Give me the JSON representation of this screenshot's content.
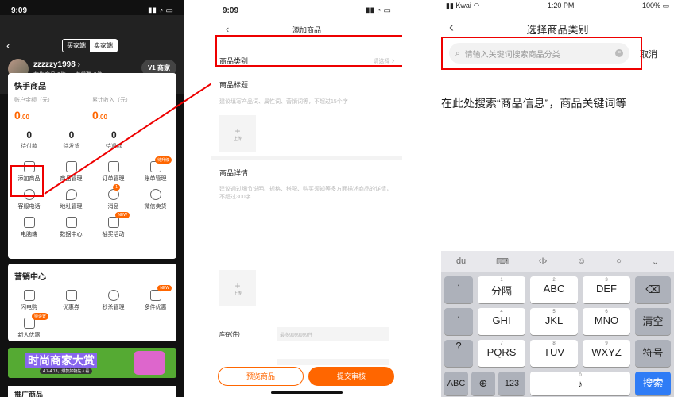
{
  "panel1": {
    "status_time": "9:09",
    "seg_buyer": "买家端",
    "seg_seller": "卖家端",
    "username": "zzzzzy1998",
    "stat_sale": "在售商品 2件",
    "stat_sold": "总销量 0件",
    "merchant": "商家",
    "section_title": "快手商品",
    "balance_label": "账户金额（元）",
    "balance_value": "0",
    "balance_dec": ".00",
    "income_label": "累计收入（元）",
    "income_value": "0",
    "income_dec": ".00",
    "orders": [
      {
        "n": "0",
        "label": "待付款"
      },
      {
        "n": "0",
        "label": "待发货"
      },
      {
        "n": "0",
        "label": "待退款"
      }
    ],
    "tools": [
      {
        "label": "添加商品",
        "badge": ""
      },
      {
        "label": "商品管理",
        "badge": ""
      },
      {
        "label": "订单管理",
        "badge": ""
      },
      {
        "label": "账单管理",
        "badge": "待升级"
      },
      {
        "label": "客服电话",
        "badge": ""
      },
      {
        "label": "地址管理",
        "badge": ""
      },
      {
        "label": "消息",
        "badge": "1"
      },
      {
        "label": "微信卖货",
        "badge": ""
      },
      {
        "label": "电脑端",
        "badge": ""
      },
      {
        "label": "数据中心",
        "badge": ""
      },
      {
        "label": "抽奖活动",
        "badge": "NEW"
      }
    ],
    "marketing_title": "营销中心",
    "marketing": [
      {
        "label": "闪电购",
        "badge": ""
      },
      {
        "label": "优惠券",
        "badge": ""
      },
      {
        "label": "秒杀管理",
        "badge": ""
      },
      {
        "label": "多件优惠",
        "badge": "NEW"
      },
      {
        "label": "新人优惠",
        "badge": "待设置"
      }
    ],
    "banner_title": "时尚商家大赏",
    "banner_sub": "4.7-4.13，爆款好物先人看",
    "footer_title": "推广商品"
  },
  "panel2": {
    "status_time": "9:09",
    "title": "添加商品",
    "category_label": "商品类别",
    "category_value": "请选择",
    "name_label": "商品标题",
    "name_hint": "建议填写产品词、属性词、营销词等，不超过15个字",
    "upload": "上传",
    "detail_label": "商品详情",
    "detail_hint": "建议通过细节说明、规格、搭配、购买须知等多方面描述商品的详情，不超过300字",
    "stock_label": "库存(件)",
    "stock_placeholder": "最多9999999件",
    "preview_btn": "预览商品",
    "submit_btn": "提交审核"
  },
  "panel3": {
    "carrier": "Kwai",
    "status_time": "1:20 PM",
    "battery": "100%",
    "title": "选择商品类别",
    "search_placeholder": "请输入关键词搜索商品分类",
    "cancel": "取消",
    "hint": "在此处搜索“商品信息”，商品关键词等",
    "keys": {
      "k1": ",",
      "k2": "分隔",
      "k3": "ABC",
      "k4": "DEF",
      "k5": ".",
      "k6": "GHI",
      "k7": "JKL",
      "k8": "MNO",
      "k9": "清空",
      "k10": "?",
      "k11": "PQRS",
      "k12": "TUV",
      "k13": "WXYZ",
      "k14": "符号",
      "k15": "ABC",
      "k16": "123",
      "k17": "搜索",
      "n1": "1",
      "n2": "2",
      "n3": "3",
      "n4": "4",
      "n5": "5",
      "n6": "6",
      "n7": "7",
      "n8": "8",
      "n9": "9",
      "n0": "0"
    }
  },
  "colors": {
    "accent": "#ff6600",
    "highlight": "#e00000"
  }
}
